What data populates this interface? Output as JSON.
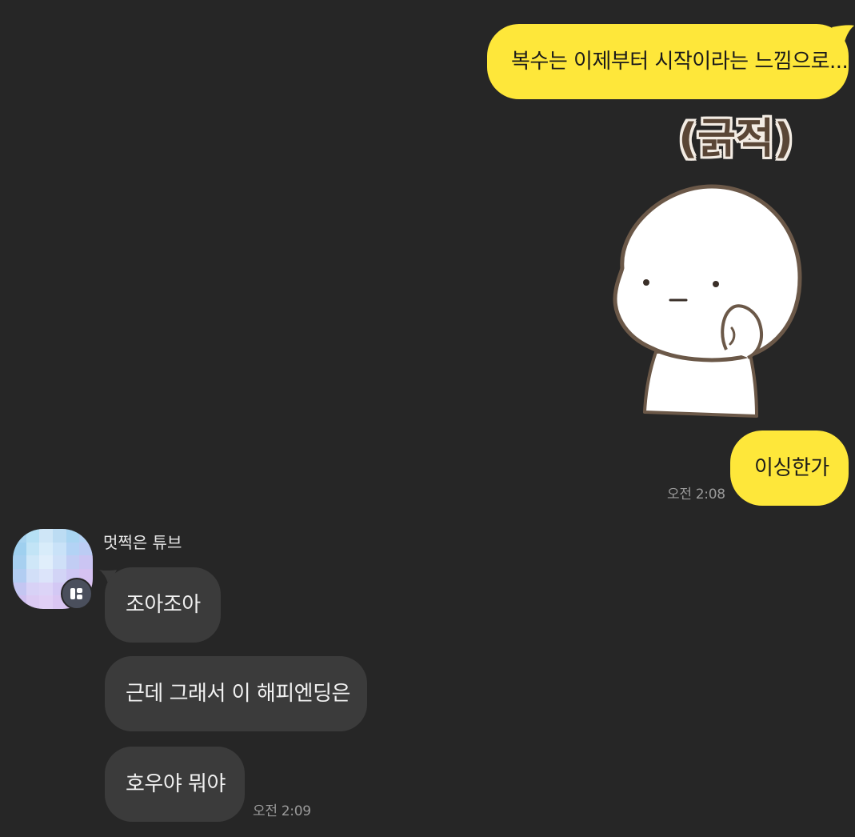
{
  "messages_mine": [
    {
      "text": "복수는 이제부터 시작이라는 느낌으로..."
    },
    {
      "text": "이싱한가"
    }
  ],
  "sticker": {
    "caption": "(긁적)",
    "description_icon": "head-scratch-character-sticker"
  },
  "my_time": "오전 2:08",
  "other_user": {
    "name": "멋쩍은 튜브",
    "badge_icon": "profile-badge-icon"
  },
  "messages_theirs": [
    {
      "text": "조아조아"
    },
    {
      "text": "근데 그래서 이 해피엔딩은"
    },
    {
      "text": "호우야 뭐야"
    }
  ],
  "their_time": "오전 2:09",
  "colors": {
    "background": "#262626",
    "my_bubble": "#fee73a",
    "their_bubble": "#3b3b3b",
    "time_text": "#9a9a9a"
  }
}
